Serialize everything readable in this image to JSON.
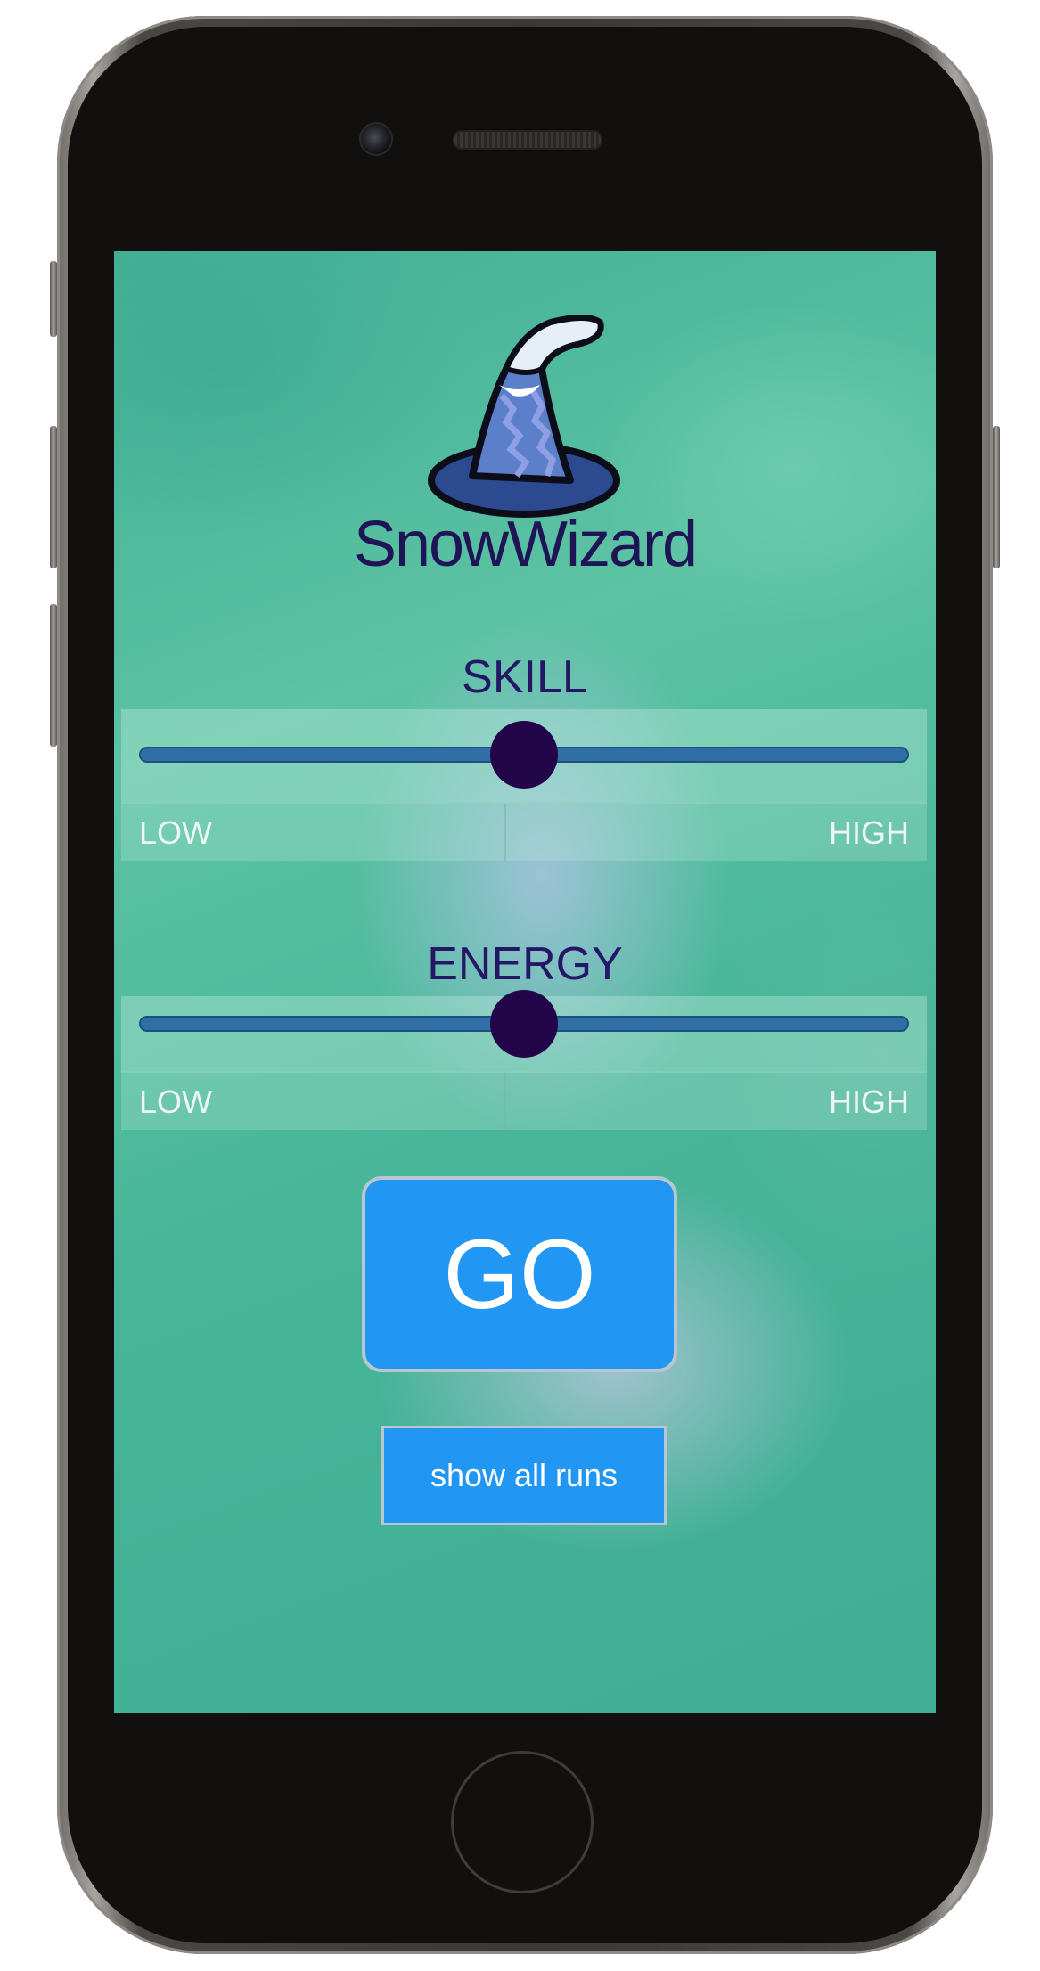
{
  "app": {
    "title": "SnowWizard"
  },
  "sliders": [
    {
      "label": "SKILL",
      "low_label": "LOW",
      "high_label": "HIGH",
      "value_percent": 50
    },
    {
      "label": "ENERGY",
      "low_label": "LOW",
      "high_label": "HIGH",
      "value_percent": 50
    }
  ],
  "buttons": {
    "go_label": "GO",
    "show_runs_label": "show all runs"
  },
  "colors": {
    "accent_button": "#2196f3",
    "title_text": "#1f1556",
    "slider_thumb": "#23064a",
    "slider_track": "#2f6fa6"
  },
  "icons": {
    "logo": "wizard-hat-icon"
  }
}
